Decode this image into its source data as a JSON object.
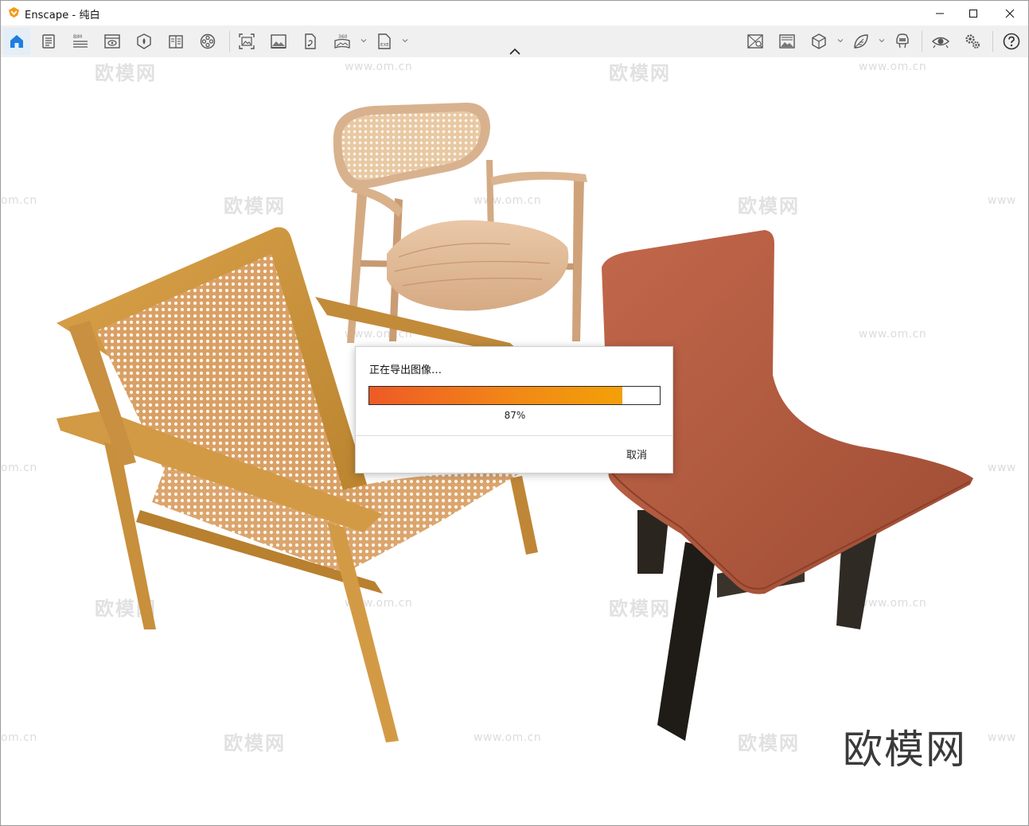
{
  "window": {
    "title": "Enscape - 纯白",
    "controls": [
      "minimize",
      "maximize",
      "close"
    ]
  },
  "toolbar": {
    "left_items": [
      {
        "name": "home",
        "icon": "home-icon",
        "active": true
      },
      {
        "name": "document",
        "icon": "document-icon"
      },
      {
        "name": "bim",
        "icon": "bim-icon",
        "label": "BIM"
      },
      {
        "name": "view-management",
        "icon": "eye-window-icon"
      },
      {
        "name": "asset-library",
        "icon": "asset-icon"
      },
      {
        "name": "material-editor",
        "icon": "book-icon"
      },
      {
        "name": "video-editor",
        "icon": "film-reel-icon"
      },
      {
        "name": "screenshot",
        "icon": "screenshot-icon"
      },
      {
        "name": "batch-render",
        "icon": "image-icon"
      },
      {
        "name": "export",
        "icon": "export-icon"
      },
      {
        "name": "panorama",
        "icon": "panorama-360-icon",
        "label": "360"
      },
      {
        "name": "exe-export",
        "icon": "exe-icon",
        "label": "EXE"
      }
    ],
    "right_items": [
      {
        "name": "visual-settings",
        "icon": "visual-settings-icon"
      },
      {
        "name": "atmosphere",
        "icon": "atmosphere-icon"
      },
      {
        "name": "cube-view",
        "icon": "cube-icon"
      },
      {
        "name": "fog",
        "icon": "leaf-icon"
      },
      {
        "name": "vr-headset",
        "icon": "vr-headset-icon"
      },
      {
        "name": "view-settings",
        "icon": "eye-icon"
      },
      {
        "name": "settings",
        "icon": "gears-icon"
      },
      {
        "name": "help",
        "icon": "help-icon"
      }
    ]
  },
  "watermark": {
    "brand": "欧模网",
    "url": "www.om.cn",
    "url_partial": "om.cn",
    "url_prefix": "www"
  },
  "corner_logo": "欧模网",
  "dialog": {
    "title": "正在导出图像…",
    "progress": 0.87,
    "percent_label": "87%",
    "cancel_label": "取消"
  },
  "colors": {
    "accent": "#f28a16",
    "progress_start": "#ee5a26",
    "home_active": "#1f7de0"
  }
}
